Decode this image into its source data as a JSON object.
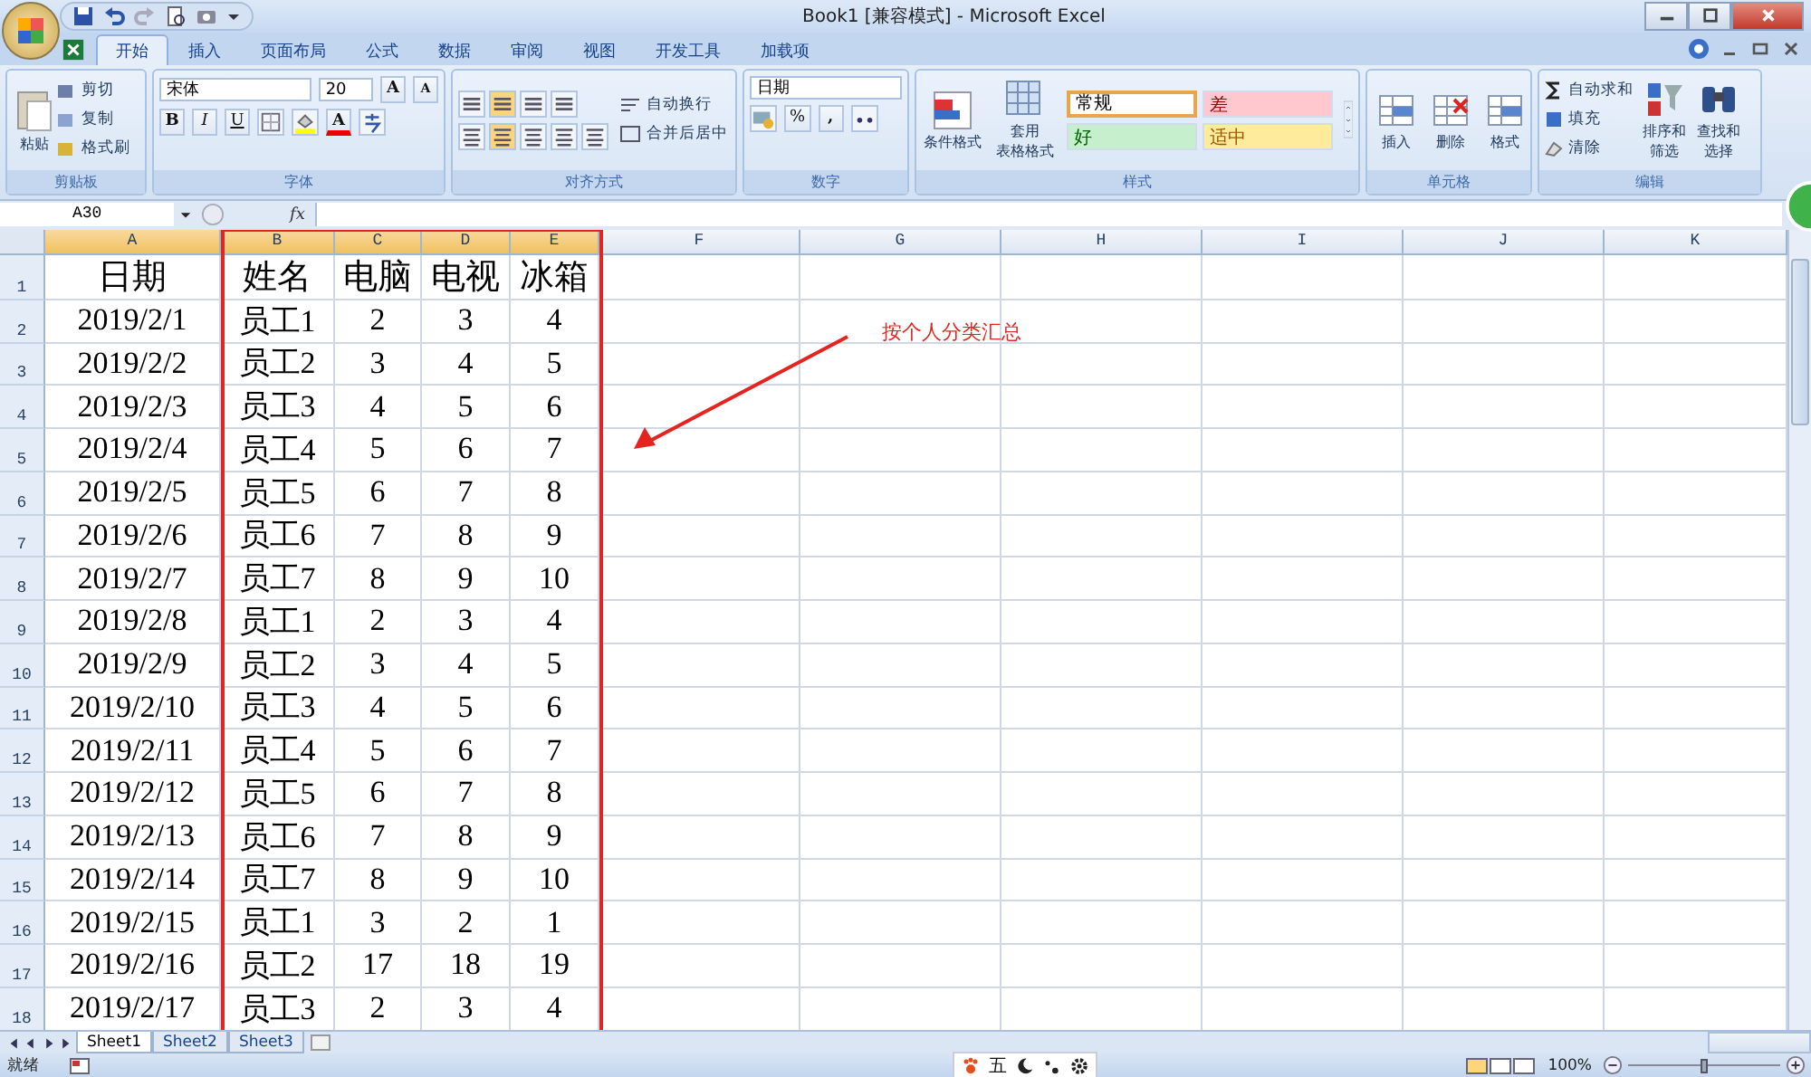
{
  "window": {
    "title": "Book1  [兼容模式] - Microsoft Excel"
  },
  "tabs": [
    {
      "label": "开始",
      "selected": true
    },
    {
      "label": "插入",
      "selected": false
    },
    {
      "label": "页面布局",
      "selected": false
    },
    {
      "label": "公式",
      "selected": false
    },
    {
      "label": "数据",
      "selected": false
    },
    {
      "label": "审阅",
      "selected": false
    },
    {
      "label": "视图",
      "selected": false
    },
    {
      "label": "开发工具",
      "selected": false
    },
    {
      "label": "加载项",
      "selected": false
    }
  ],
  "ribbon": {
    "clipboard": {
      "label": "剪贴板",
      "paste": "粘贴",
      "items": [
        "剪切",
        "复制",
        "格式刷"
      ]
    },
    "font": {
      "label": "字体",
      "family": "宋体",
      "size": "20",
      "grow": "A",
      "shrink": "A",
      "bold": "B",
      "italic": "I",
      "underline": "U",
      "color_letter": "A"
    },
    "alignment": {
      "label": "对齐方式",
      "wrap": "自动换行",
      "merge": "合并后居中"
    },
    "number": {
      "label": "数字",
      "format": "日期",
      "percent": "%",
      "comma": ","
    },
    "styles": {
      "label": "样式",
      "conditional": "条件格式",
      "table": [
        "套用",
        "表格格式"
      ],
      "cells": [
        {
          "label": "常规",
          "color": "#ffffff"
        },
        {
          "label": "差",
          "color": "#ffc7ce"
        },
        {
          "label": "好",
          "color": "#c6efce"
        },
        {
          "label": "适中",
          "color": "#ffeb9c"
        }
      ]
    },
    "cells": {
      "label": "单元格",
      "items": [
        "插入",
        "删除",
        "格式"
      ]
    },
    "editing": {
      "label": "编辑",
      "items": [
        "自动求和",
        "填充",
        "清除"
      ],
      "sort": [
        "排序和",
        "筛选"
      ],
      "find": [
        "查找和",
        "选择"
      ]
    }
  },
  "formula_bar": {
    "name_box": "A30",
    "fx": "fx"
  },
  "sheet": {
    "columns": [
      {
        "label": "A",
        "selected": true
      },
      {
        "label": "B",
        "selected": true
      },
      {
        "label": "C",
        "selected": true
      },
      {
        "label": "D",
        "selected": true
      },
      {
        "label": "E",
        "selected": true
      },
      {
        "label": "F",
        "selected": false
      },
      {
        "label": "G",
        "selected": false
      },
      {
        "label": "H",
        "selected": false
      },
      {
        "label": "I",
        "selected": false
      },
      {
        "label": "J",
        "selected": false
      },
      {
        "label": "K",
        "selected": false
      }
    ],
    "rows": [
      {
        "label": "1",
        "cells": [
          "日期",
          "姓名",
          "电脑",
          "电视",
          "冰箱"
        ]
      },
      {
        "label": "2",
        "cells": [
          "2019/2/1",
          "员工1",
          "2",
          "3",
          "4"
        ]
      },
      {
        "label": "3",
        "cells": [
          "2019/2/2",
          "员工2",
          "3",
          "4",
          "5"
        ]
      },
      {
        "label": "4",
        "cells": [
          "2019/2/3",
          "员工3",
          "4",
          "5",
          "6"
        ]
      },
      {
        "label": "5",
        "cells": [
          "2019/2/4",
          "员工4",
          "5",
          "6",
          "7"
        ]
      },
      {
        "label": "6",
        "cells": [
          "2019/2/5",
          "员工5",
          "6",
          "7",
          "8"
        ]
      },
      {
        "label": "7",
        "cells": [
          "2019/2/6",
          "员工6",
          "7",
          "8",
          "9"
        ]
      },
      {
        "label": "8",
        "cells": [
          "2019/2/7",
          "员工7",
          "8",
          "9",
          "10"
        ]
      },
      {
        "label": "9",
        "cells": [
          "2019/2/8",
          "员工1",
          "2",
          "3",
          "4"
        ]
      },
      {
        "label": "10",
        "cells": [
          "2019/2/9",
          "员工2",
          "3",
          "4",
          "5"
        ]
      },
      {
        "label": "11",
        "cells": [
          "2019/2/10",
          "员工3",
          "4",
          "5",
          "6"
        ]
      },
      {
        "label": "12",
        "cells": [
          "2019/2/11",
          "员工4",
          "5",
          "6",
          "7"
        ]
      },
      {
        "label": "13",
        "cells": [
          "2019/2/12",
          "员工5",
          "6",
          "7",
          "8"
        ]
      },
      {
        "label": "14",
        "cells": [
          "2019/2/13",
          "员工6",
          "7",
          "8",
          "9"
        ]
      },
      {
        "label": "15",
        "cells": [
          "2019/2/14",
          "员工7",
          "8",
          "9",
          "10"
        ]
      },
      {
        "label": "16",
        "cells": [
          "2019/2/15",
          "员工1",
          "3",
          "2",
          "1"
        ]
      },
      {
        "label": "17",
        "cells": [
          "2019/2/16",
          "员工2",
          "17",
          "18",
          "19"
        ]
      },
      {
        "label": "18",
        "cells": [
          "2019/2/17",
          "员工3",
          "2",
          "3",
          "4"
        ]
      }
    ]
  },
  "annotation": {
    "text": "按个人分类汇总"
  },
  "sheet_tabs": [
    {
      "label": "Sheet1",
      "selected": true
    },
    {
      "label": "Sheet2",
      "selected": false
    },
    {
      "label": "Sheet3",
      "selected": false
    }
  ],
  "status_bar": {
    "text": "就绪",
    "ime": "五",
    "zoom": "100%",
    "zoom_slider": {
      "level": 0.5
    }
  }
}
